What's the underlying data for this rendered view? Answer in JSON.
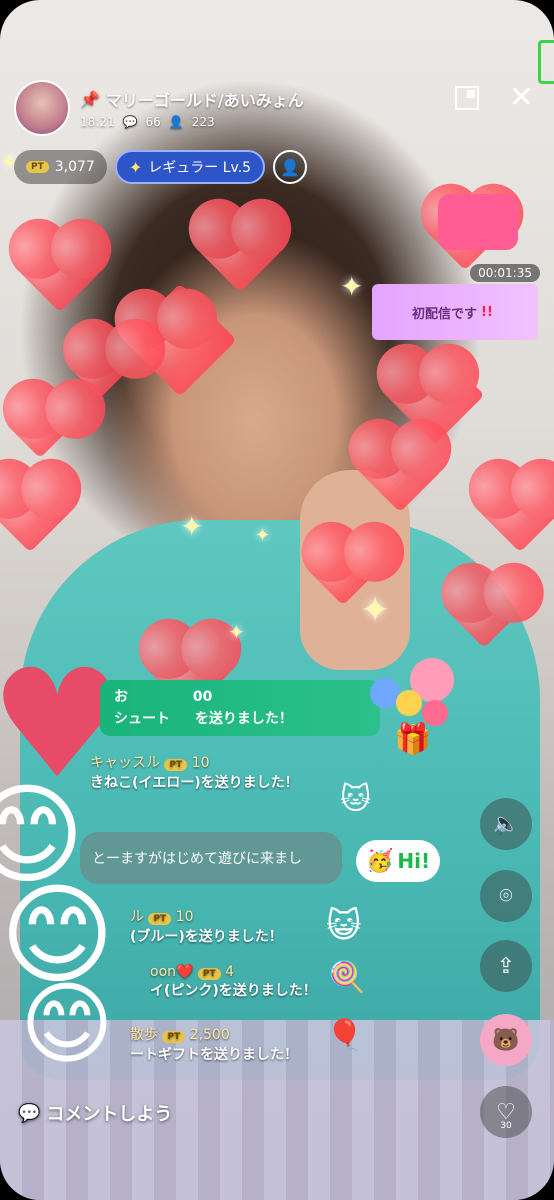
{
  "header": {
    "streamer_name": "マリーゴールド/あいみょん",
    "time": "18:21",
    "comments_count": "66",
    "viewers_count": "223"
  },
  "stats": {
    "points": "3,077",
    "pt_badge": "PT",
    "rank_label": "レギュラー Lv.5"
  },
  "overlay": {
    "timer": "00:01:35",
    "banner_text": "初配信です",
    "banner_mark": "!!"
  },
  "gift_notice": {
    "line1": "お",
    "line1_value": "00",
    "line2": "シュート",
    "line2_suffix": "を送りました！"
  },
  "chat": [
    {
      "name": "キャッスル",
      "pt": "10",
      "msg": "きねこ(イエロー)を送りました！"
    },
    {
      "name": "",
      "pt": "",
      "msg": "とーますがはじめて遊びに来まし"
    },
    {
      "name": "ル",
      "pt": "10",
      "msg": "(ブルー)を送りました！"
    },
    {
      "name": "oon❤️",
      "pt": "4",
      "msg": "イ(ピンク)を送りました！"
    },
    {
      "name": "散歩",
      "pt": "2,500",
      "msg": "ートギフトを送りました！"
    }
  ],
  "hi_bubble": "Hi!",
  "comment_placeholder": "コメントしよう",
  "like_count": "30",
  "colors": {
    "accent_green": "#19b47a",
    "rank_blue": "#2d55c8",
    "pt_gold": "#e8c54a"
  }
}
